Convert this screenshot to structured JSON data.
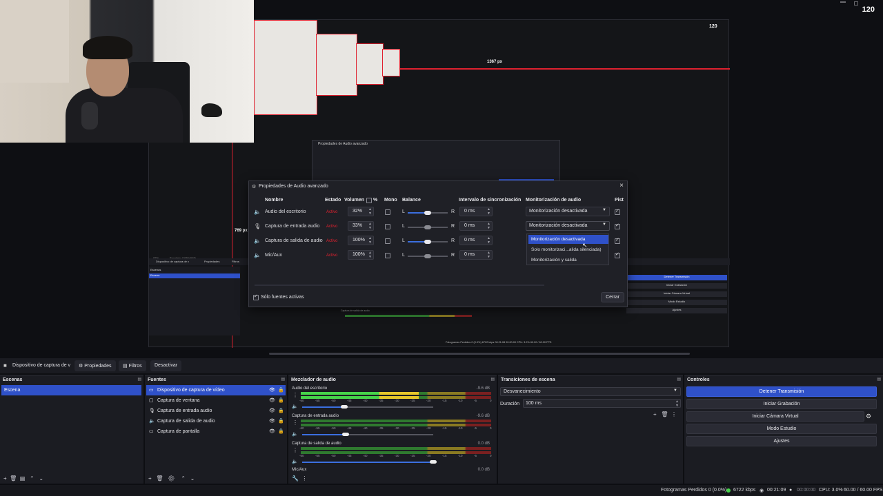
{
  "preview": {
    "corner_number": "120",
    "nested": {
      "dialog_title": "Propiedades de Audio avanzado",
      "px_label": "1367 px",
      "px_label_side": "769 px",
      "zoom": "87%",
      "scale": "Escalado (1686x948)",
      "source_label": "Dispositivo de captura de v",
      "props_label": "Propiedades",
      "filters_label": "Filtros",
      "scenes_row": "Escenas",
      "scene_row": "Escena",
      "ctrl_stop": "Detener Transmisión",
      "ctrl_rec": "Iniciar Grabación",
      "ctrl_vcam": "Iniciar Cámara Virtual",
      "ctrl_studio": "Modo Estudio",
      "ctrl_settings": "Ajustes",
      "mixer_label": "Captura de salida de audio",
      "status": "Fotogramas Perdidos 0 (0.0%)    6722 kbps    00:21:08    00:00:00    CPU: 3.0%    60.00 / 60.00 FPS"
    }
  },
  "dialog": {
    "title": "Propiedades de Audio avanzado",
    "close": "×",
    "headers": {
      "name": "Nombre",
      "state": "Estado",
      "volume": "Volumen",
      "percent": "%",
      "mono": "Mono",
      "balance": "Balance",
      "sync": "Intervalo de sincronización",
      "monitor": "Monitorización de audio",
      "tracks": "Pist"
    },
    "rows": [
      {
        "name": "Audio del escritorio",
        "state": "Activo",
        "volume": "32%",
        "balance_left": "L",
        "balance_right": "R",
        "sync": "0 ms",
        "monitor": "Monitorización desactivada",
        "icon": "speaker-icon"
      },
      {
        "name": "Captura de entrada audio",
        "state": "Activo",
        "volume": "33%",
        "balance_left": "L",
        "balance_right": "R",
        "sync": "0 ms",
        "monitor": "Monitorización desactivada",
        "icon": "mic-icon"
      },
      {
        "name": "Captura de salida de audio",
        "state": "Activo",
        "volume": "100%",
        "balance_left": "L",
        "balance_right": "R",
        "sync": "0 ms",
        "monitor": "",
        "icon": "speaker-icon"
      },
      {
        "name": "Mic/Aux",
        "state": "Activo",
        "volume": "100%",
        "balance_left": "L",
        "balance_right": "R",
        "sync": "0 ms",
        "monitor": "",
        "icon": "mic-icon"
      }
    ],
    "monitor_options": [
      "Monitorización desactivada",
      "Solo monitorizaci...alida silenciada)",
      "Monitorización y salida"
    ],
    "only_active_label": "Sólo fuentes activas",
    "close_button": "Cerrar"
  },
  "toolbar": {
    "source_name": "Dispositivo de captura de v",
    "properties": "Propiedades",
    "filters": "Filtros",
    "deactivate": "Desactivar"
  },
  "scenes": {
    "title": "Escenas",
    "items": [
      "Escena"
    ]
  },
  "sources": {
    "title": "Fuentes",
    "items": [
      {
        "label": "Dispositivo de captura de vídeo",
        "icon": "camera-icon"
      },
      {
        "label": "Captura de ventana",
        "icon": "window-icon"
      },
      {
        "label": "Captura de entrada audio",
        "icon": "mic-icon"
      },
      {
        "label": "Captura de salida de audio",
        "icon": "speaker-icon"
      },
      {
        "label": "Captura de pantalla",
        "icon": "monitor-icon"
      }
    ]
  },
  "mixer": {
    "title": "Mezclador de audio",
    "ticks": [
      "-60",
      "-55",
      "-50",
      "-45",
      "-40",
      "-35",
      "-30",
      "-25",
      "-20",
      "-15",
      "-10",
      "-5",
      "0"
    ],
    "channels": [
      {
        "name": "Audio del escritorio",
        "db": "-9.6 dB",
        "level": 0.62,
        "volume": 0.32
      },
      {
        "name": "Captura de entrada audio",
        "db": "-9.6 dB",
        "level": 0.0,
        "volume": 0.33
      },
      {
        "name": "Captura de salida de audio",
        "db": "0.0 dB",
        "level": 0.0,
        "volume": 1.0
      },
      {
        "name": "Mic/Aux",
        "db": "0.0 dB",
        "level": 0.0,
        "volume": 1.0
      }
    ]
  },
  "transitions": {
    "title": "Transiciones de escena",
    "selected": "Desvanecimiento",
    "duration_label": "Duración",
    "duration_value": "100 ms"
  },
  "controls": {
    "title": "Controles",
    "stop_stream": "Detener Transmisión",
    "start_recording": "Iniciar Grabación",
    "start_vcam": "Iniciar Cámara Virtual",
    "studio_mode": "Modo Estudio",
    "settings": "Ajustes"
  },
  "status": {
    "dropped": "Fotogramas Perdidos 0 (0.0%)",
    "bitrate": "6722 kbps",
    "live_time": "00:21:09",
    "rec_time": "00:00:00",
    "cpu": "CPU: 3.0%",
    "fps": "60.00 / 60.00 FPS"
  },
  "colors": {
    "accent": "#2f51c9",
    "red": "#e0212f",
    "meter_green": "#46d34a",
    "meter_yellow": "#e6c62a"
  }
}
